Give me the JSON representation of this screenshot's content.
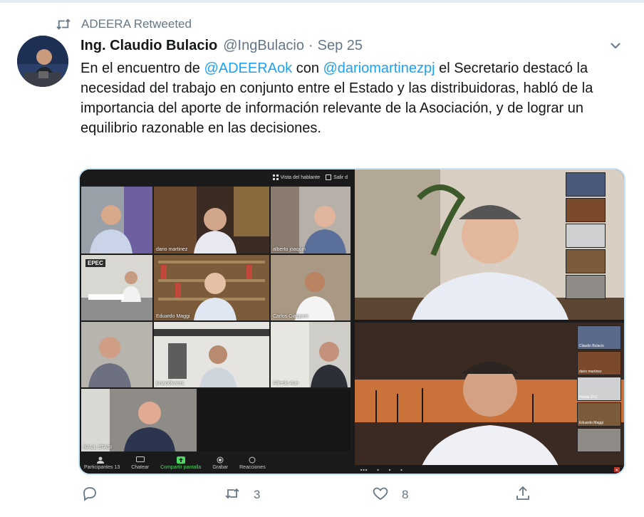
{
  "retweet": {
    "label": "ADEERA Retweeted"
  },
  "tweet": {
    "author_name": "Ing. Claudio Bulacio",
    "author_handle": "@IngBulacio",
    "separator": "·",
    "date": "Sep 25",
    "text_parts": {
      "p1": "En el encuentro de ",
      "m1": "@ADEERAok",
      "p2": " con ",
      "m2": "@dariomartinezpj",
      "p3": " el Secretario destacó la necesidad del trabajo en conjunto entre el Estado y las distribuidoras, habló de la importancia del aporte de información relevante de la Asociación, y de lograr un equilibrio razonable en las decisiones."
    }
  },
  "media": {
    "zoom_topbar": {
      "speaker_view": "Vista del hablante",
      "exit": "Salir d"
    },
    "tiles": {
      "t2": "dario martinez",
      "t3": "alberto joaquin",
      "t4_logo": "EPEC",
      "t5": "Eduardo Maggi",
      "t6": "Carlos Ciapponi",
      "t8": "jusandivaras",
      "t9": "Alfredo Aun",
      "t10": "RAUL STASI"
    },
    "zoom_bottombar": {
      "participants": "Participantes",
      "participants_count": "13",
      "chat": "Chatear",
      "share": "Compartir pantalla",
      "record": "Grabar",
      "reactions": "Reacciones"
    },
    "right_bottom_minis": {
      "m1": "Claudio Bulacio",
      "m2": "dario martinez",
      "m3": "Pirada ENC",
      "m4": "Eduardo Maggi"
    }
  },
  "actions": {
    "reply_count": "",
    "retweet_count": "3",
    "like_count": "8"
  },
  "colors": {
    "accent": "#1da1f2",
    "muted": "#657786",
    "text": "#14171a"
  }
}
